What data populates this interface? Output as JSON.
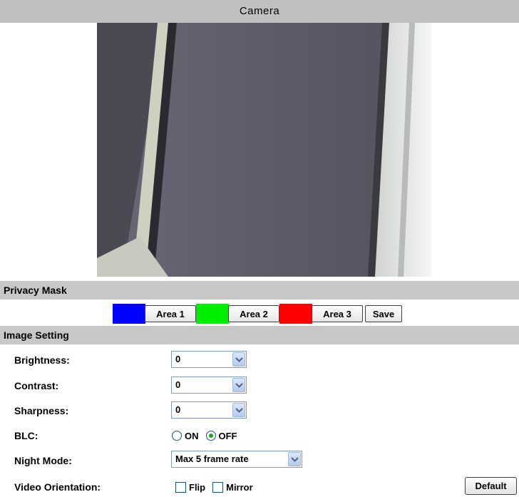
{
  "header": {
    "title": "Camera"
  },
  "privacy_mask": {
    "title": "Privacy Mask",
    "areas": [
      {
        "label": "Area 1",
        "color": "#0000ff"
      },
      {
        "label": "Area 2",
        "color": "#00ee00"
      },
      {
        "label": "Area 3",
        "color": "#ff0000"
      }
    ],
    "save_label": "Save"
  },
  "image_setting": {
    "title": "Image Setting",
    "brightness": {
      "label": "Brightness:",
      "value": "0"
    },
    "contrast": {
      "label": "Contrast:",
      "value": "0"
    },
    "sharpness": {
      "label": "Sharpness:",
      "value": "0"
    },
    "blc": {
      "label": "BLC:",
      "options": [
        "ON",
        "OFF"
      ],
      "selected": "OFF"
    },
    "night_mode": {
      "label": "Night Mode:",
      "value": "Max 5 frame rate"
    },
    "video_orientation": {
      "label": "Video Orientation:",
      "options": [
        "Flip",
        "Mirror"
      ]
    },
    "default_label": "Default"
  },
  "icons": {
    "dropdown": "chevron-down-icon"
  }
}
